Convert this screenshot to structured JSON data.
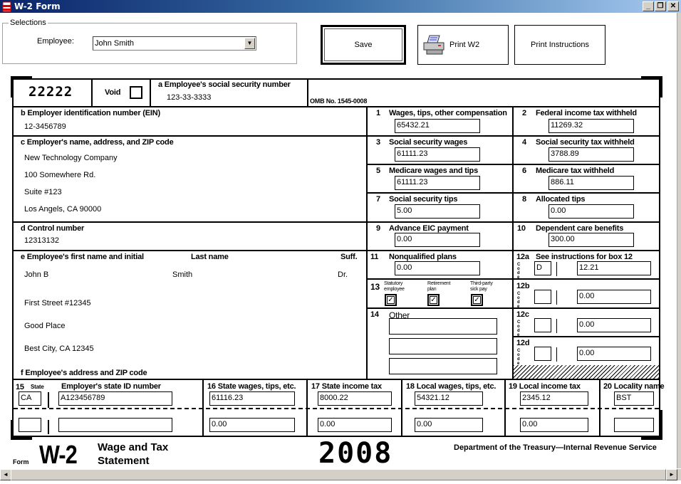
{
  "window": {
    "title": "W-2 Form",
    "minimize_glyph": "_",
    "restore_glyph": "❐",
    "close_glyph": "✕"
  },
  "selections": {
    "legend": "Selections",
    "employee_label": "Employee:",
    "employee_value": "John Smith"
  },
  "toolbar": {
    "save_label": "Save",
    "print_w2_label": "Print W2",
    "print_instructions_label": "Print Instructions"
  },
  "form": {
    "control_code": "22222",
    "void_label": "Void",
    "void_checked": false,
    "a_label": "a  Employee's social security number",
    "a_value": "123-33-3333",
    "omb": "OMB No. 1545-0008",
    "b_label": "b  Employer identification number (EIN)",
    "b_value": "12-3456789",
    "c_label": "c  Employer's name, address, and ZIP code",
    "c_lines": [
      "New Technology Company",
      "100 Somewhere Rd.",
      "Suite #123",
      "Los Angels, CA 90000"
    ],
    "d_label": "d  Control number",
    "d_value": "12313132",
    "e_label": "e  Employee's first name and initial",
    "e_last_label": "Last name",
    "e_suff_label": "Suff.",
    "e_first": "John B",
    "e_last": "Smith",
    "e_suff": "Dr.",
    "f_lines": [
      "First Street #12345",
      "Good Place",
      "Best City, CA 12345"
    ],
    "f_label": "f  Employee's address and ZIP code",
    "boxes": {
      "b1": {
        "num": "1",
        "label": "Wages, tips, other compensation",
        "value": "65432.21"
      },
      "b2": {
        "num": "2",
        "label": "Federal income tax withheld",
        "value": "11269.32"
      },
      "b3": {
        "num": "3",
        "label": "Social security wages",
        "value": "61111.23"
      },
      "b4": {
        "num": "4",
        "label": "Social security tax withheld",
        "value": "3788.89"
      },
      "b5": {
        "num": "5",
        "label": "Medicare wages and tips",
        "value": "61111.23"
      },
      "b6": {
        "num": "6",
        "label": "Medicare tax withheld",
        "value": "886.11"
      },
      "b7": {
        "num": "7",
        "label": "Social security tips",
        "value": "5.00"
      },
      "b8": {
        "num": "8",
        "label": "Allocated tips",
        "value": "0.00"
      },
      "b9": {
        "num": "9",
        "label": "Advance EIC payment",
        "value": "0.00"
      },
      "b10": {
        "num": "10",
        "label": "Dependent care benefits",
        "value": "300.00"
      },
      "b11": {
        "num": "11",
        "label": "Nonqualified plans",
        "value": "0.00"
      },
      "b12a": {
        "num": "12a",
        "label": "See instructions for box 12",
        "code": "D",
        "value": "12.21"
      },
      "b12b": {
        "num": "12b",
        "code": "",
        "value": "0.00"
      },
      "b12c": {
        "num": "12c",
        "code": "",
        "value": "0.00"
      },
      "b12d": {
        "num": "12d",
        "code": "",
        "value": "0.00"
      },
      "b13": {
        "num": "13",
        "statutory_label_1": "Statutory",
        "statutory_label_2": "employee",
        "retirement_label_1": "Retirement",
        "retirement_label_2": "plan",
        "sickpay_label_1": "Third-party",
        "sickpay_label_2": "sick pay",
        "statutory_checked": true,
        "retirement_checked": true,
        "sickpay_checked": true,
        "check_glyph": "✓"
      },
      "b14": {
        "num": "14",
        "label": "Other",
        "values": [
          "",
          "",
          ""
        ]
      },
      "code_letters": "Code"
    },
    "state_rows": {
      "b15_num": "15",
      "b15_state_label": "State",
      "b15_id_label": "Employer's state ID number",
      "b16_label": "16 State wages, tips, etc.",
      "b17_label": "17 State income tax",
      "b18_label": "18 Local wages, tips, etc.",
      "b19_label": "19 Local income tax",
      "b20_label": "20 Locality name",
      "rows": [
        {
          "state": "CA",
          "state_id": "A123456789",
          "state_wages": "61116.23",
          "state_tax": "8000.22",
          "local_wages": "54321.12",
          "local_tax": "2345.12",
          "locality": "BST"
        },
        {
          "state": "",
          "state_id": "",
          "state_wages": "0.00",
          "state_tax": "0.00",
          "local_wages": "0.00",
          "local_tax": "0.00",
          "locality": ""
        }
      ]
    },
    "footer": {
      "form_word": "Form",
      "form_name": "W-2",
      "title_1": "Wage and Tax",
      "title_2": "Statement",
      "year": "2008",
      "agency": "Department of the Treasury—Internal Revenue Service"
    }
  },
  "scrollbar": {
    "left_glyph": "◄",
    "right_glyph": "►"
  }
}
